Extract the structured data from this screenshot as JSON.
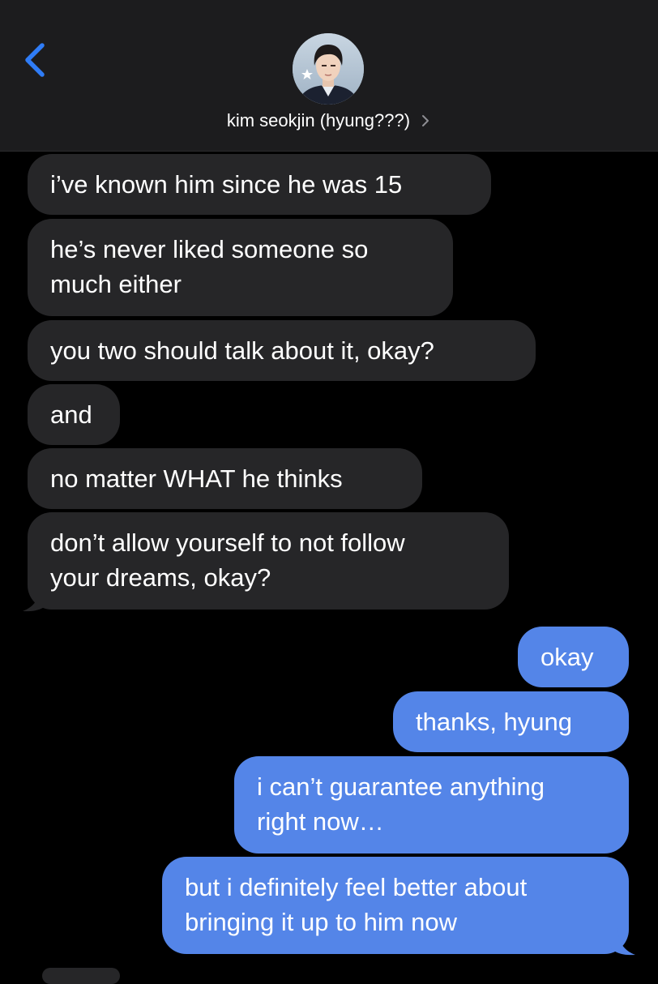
{
  "header": {
    "back_icon": "chevron-left-icon",
    "contact_name": "kim seokjin (hyung???)",
    "chevron_icon": "chevron-right-icon",
    "avatar_icon": "contact-avatar-photo",
    "avatar_badge_icon": "star-icon"
  },
  "colors": {
    "incoming_bubble": "#262628",
    "outgoing_bubble": "#5485e8",
    "header_bg": "#1c1c1e",
    "accent_blue": "#2f7cf6",
    "background": "#000000"
  },
  "messages": [
    {
      "direction": "incoming",
      "lines": [
        "i’ve known him since he was 15"
      ]
    },
    {
      "direction": "incoming",
      "lines": [
        "he’s never liked someone so",
        "much either"
      ]
    },
    {
      "direction": "incoming",
      "lines": [
        "you two should talk about it, okay?"
      ]
    },
    {
      "direction": "incoming",
      "lines": [
        "and"
      ]
    },
    {
      "direction": "incoming",
      "lines": [
        "no matter WHAT he thinks"
      ]
    },
    {
      "direction": "incoming",
      "lines": [
        "don’t allow yourself to not follow",
        "your dreams, okay?"
      ]
    },
    {
      "direction": "outgoing",
      "lines": [
        "okay"
      ]
    },
    {
      "direction": "outgoing",
      "lines": [
        "thanks, hyung"
      ]
    },
    {
      "direction": "outgoing",
      "lines": [
        "i can’t guarantee anything",
        "right now…"
      ]
    },
    {
      "direction": "outgoing",
      "lines": [
        "but i definitely feel better about",
        "bringing it up to him now"
      ]
    }
  ]
}
